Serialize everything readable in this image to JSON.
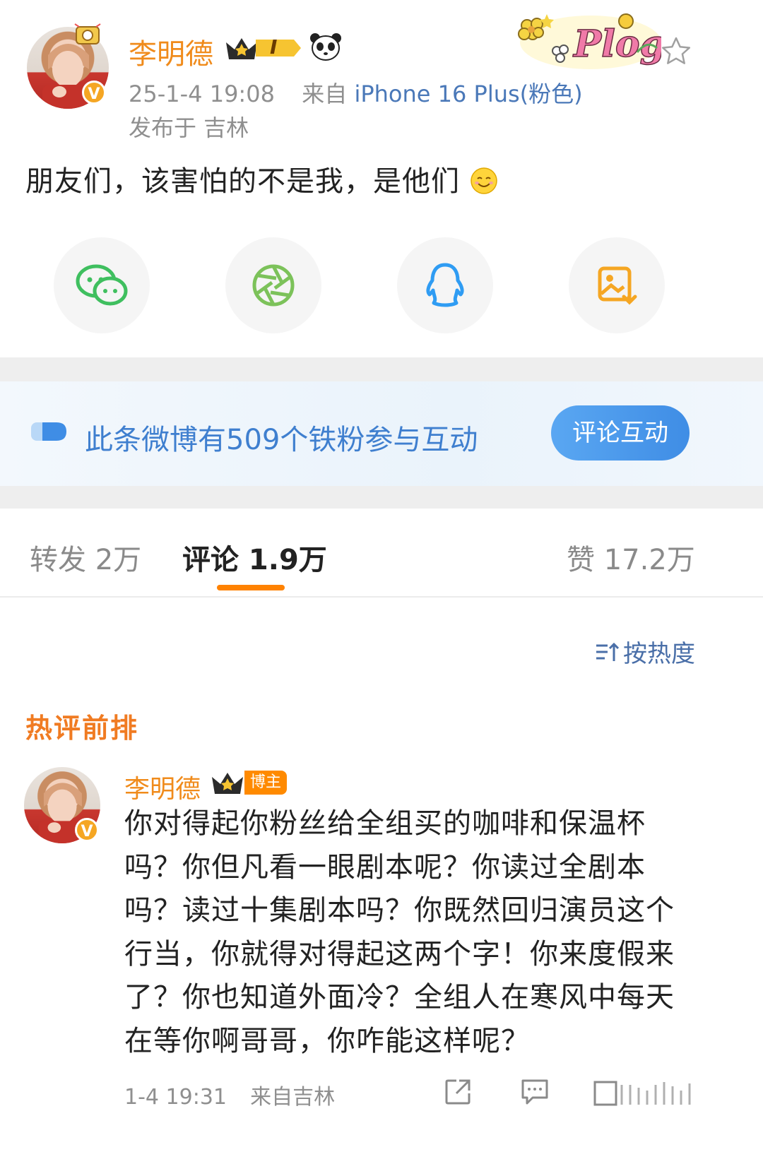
{
  "post": {
    "username": "李明德",
    "badge_level": "I",
    "timestamp": "25-1-4 19:08",
    "source_prefix": "来自",
    "device": "iPhone 16 Plus(粉色)",
    "location_line": "发布于 吉林",
    "text": "朋友们，该害怕的不是我，是他们",
    "plog_label": "Plog"
  },
  "share": {
    "items": [
      {
        "name": "wechat",
        "icon": "wechat-icon"
      },
      {
        "name": "moments",
        "icon": "moments-icon"
      },
      {
        "name": "qq",
        "icon": "qq-icon"
      },
      {
        "name": "save-image",
        "icon": "save-image-icon"
      }
    ]
  },
  "fan_banner": {
    "text": "此条微博有509个铁粉参与互动",
    "button": "评论互动"
  },
  "tabs": {
    "repost": "转发 2万",
    "comment": "评论 1.9万",
    "like": "赞 17.2万"
  },
  "sort_label": "按热度",
  "hot_section_title": "热评前排",
  "comment": {
    "username": "李明德",
    "badge": "博主",
    "text": "你对得起你粉丝给全组买的咖啡和保温杯吗？你但凡看一眼剧本呢？你读过全剧本吗？读过十集剧本吗？你既然回归演员这个行当，你就得对得起这两个字！你来度假来了？你也知道外面冷？全组人在寒风中每天在等你啊哥哥，你咋能这样呢？",
    "time": "1-4 19:31",
    "location": "来自吉林"
  },
  "colors": {
    "brand_orange": "#f08b1b",
    "link_blue": "#4a78b8",
    "tab_indicator": "#ff8200"
  }
}
